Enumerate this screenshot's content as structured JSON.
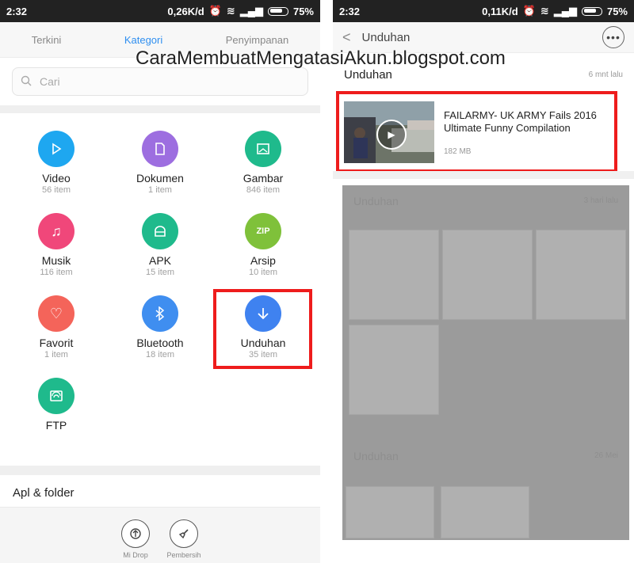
{
  "watermark": "CaraMembuatMengatasiAkun.blogspot.com",
  "left": {
    "status": {
      "time": "2:32",
      "speed": "0,26K/d",
      "battery": "75%"
    },
    "tabs": [
      {
        "label": "Terkini"
      },
      {
        "label": "Kategori",
        "active": true
      },
      {
        "label": "Penyimpanan"
      }
    ],
    "search_placeholder": "Cari",
    "categories": [
      {
        "name": "Video",
        "count": "56 item",
        "color": "#1ea7f0",
        "icon": "play-icon"
      },
      {
        "name": "Dokumen",
        "count": "1 item",
        "color": "#9d6ee0",
        "icon": "document-icon"
      },
      {
        "name": "Gambar",
        "count": "846 item",
        "color": "#1fba8c",
        "icon": "image-icon"
      },
      {
        "name": "Musik",
        "count": "116 item",
        "color": "#f0477a",
        "icon": "music-icon"
      },
      {
        "name": "APK",
        "count": "15 item",
        "color": "#1fba8c",
        "icon": "android-icon"
      },
      {
        "name": "Arsip",
        "count": "10 item",
        "color": "#7fc13a",
        "icon": "zip-icon",
        "icon_text": "ZIP"
      },
      {
        "name": "Favorit",
        "count": "1 item",
        "color": "#f4645a",
        "icon": "heart-icon"
      },
      {
        "name": "Bluetooth",
        "count": "18 item",
        "color": "#3f8ef0",
        "icon": "bluetooth-icon"
      },
      {
        "name": "Unduhan",
        "count": "35 item",
        "color": "#3f82f0",
        "icon": "download-icon"
      },
      {
        "name": "FTP",
        "count": "",
        "color": "#1fba8c",
        "icon": "ftp-icon"
      }
    ],
    "section_title": "Apl & folder",
    "tools": [
      {
        "label": "Mi Drop",
        "icon": "mi-drop-icon"
      },
      {
        "label": "Pembersih",
        "icon": "broom-icon"
      }
    ]
  },
  "right": {
    "status": {
      "time": "2:32",
      "speed": "0,11K/d",
      "battery": "75%"
    },
    "header_title": "Unduhan",
    "group_title": "Unduhan",
    "group_time": "6 mnt lalu",
    "file": {
      "title": "FAILARMY- UK ARMY Fails 2016 Ultimate Funny Compilation",
      "size": "182 MB"
    },
    "dim_groups": [
      {
        "title": "Unduhan",
        "time": "3 hari lalu"
      },
      {
        "title": "Unduhan",
        "time": "26 Mei"
      }
    ]
  }
}
